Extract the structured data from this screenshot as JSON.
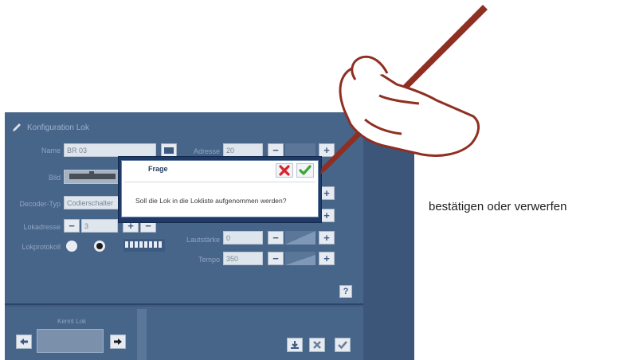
{
  "config": {
    "title": "Konfiguration Lok",
    "name_label": "Name",
    "name_value": "BR 03",
    "decoder_label": "Decoder-Typ",
    "decoder_value": "Codierschalter",
    "lokadresse_label": "Lokadresse",
    "lokadresse_value": "3",
    "protocol_label": "Lokprotokoll",
    "value_1": "20",
    "value_2": "0",
    "value_3": "350",
    "help_label": "?"
  },
  "dialog": {
    "title": "Frage",
    "message": "Soll die Lok in die Lokliste aufgenommen werden?"
  },
  "bottom": {
    "label": "Kennt Lok"
  },
  "caption": "bestätigen oder verwerfen",
  "colors": {
    "panel": "#476489",
    "dialog_frame": "#1e3a66",
    "cancel": "#d8232a",
    "confirm": "#3aa635",
    "pen": "#8f2f22"
  }
}
